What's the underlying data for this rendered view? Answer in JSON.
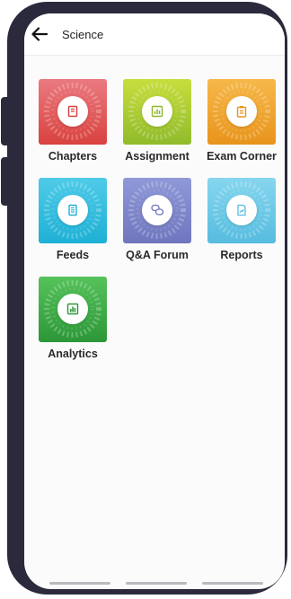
{
  "header": {
    "title": "Science",
    "back_icon": "arrow-left-icon"
  },
  "tiles": [
    {
      "label": "Chapters",
      "icon": "book-icon",
      "color_from": "#e8727a",
      "color_to": "#d9423f"
    },
    {
      "label": "Assignment",
      "icon": "bar-chart-icon",
      "color_from": "#c6dc3a",
      "color_to": "#92bd2c"
    },
    {
      "label": "Exam Corner",
      "icon": "clipboard-icon",
      "color_from": "#f5b342",
      "color_to": "#e8961e"
    },
    {
      "label": "Feeds",
      "icon": "document-icon",
      "color_from": "#48c8e6",
      "color_to": "#1fb1d6"
    },
    {
      "label": "Q&A Forum",
      "icon": "chat-bubbles-icon",
      "color_from": "#8b96d6",
      "color_to": "#7479c0"
    },
    {
      "label": "Reports",
      "icon": "report-trend-icon",
      "color_from": "#7fd2ec",
      "color_to": "#59bee0"
    },
    {
      "label": "Analytics",
      "icon": "analytics-icon",
      "color_from": "#4fbf55",
      "color_to": "#2e9a3a"
    }
  ]
}
